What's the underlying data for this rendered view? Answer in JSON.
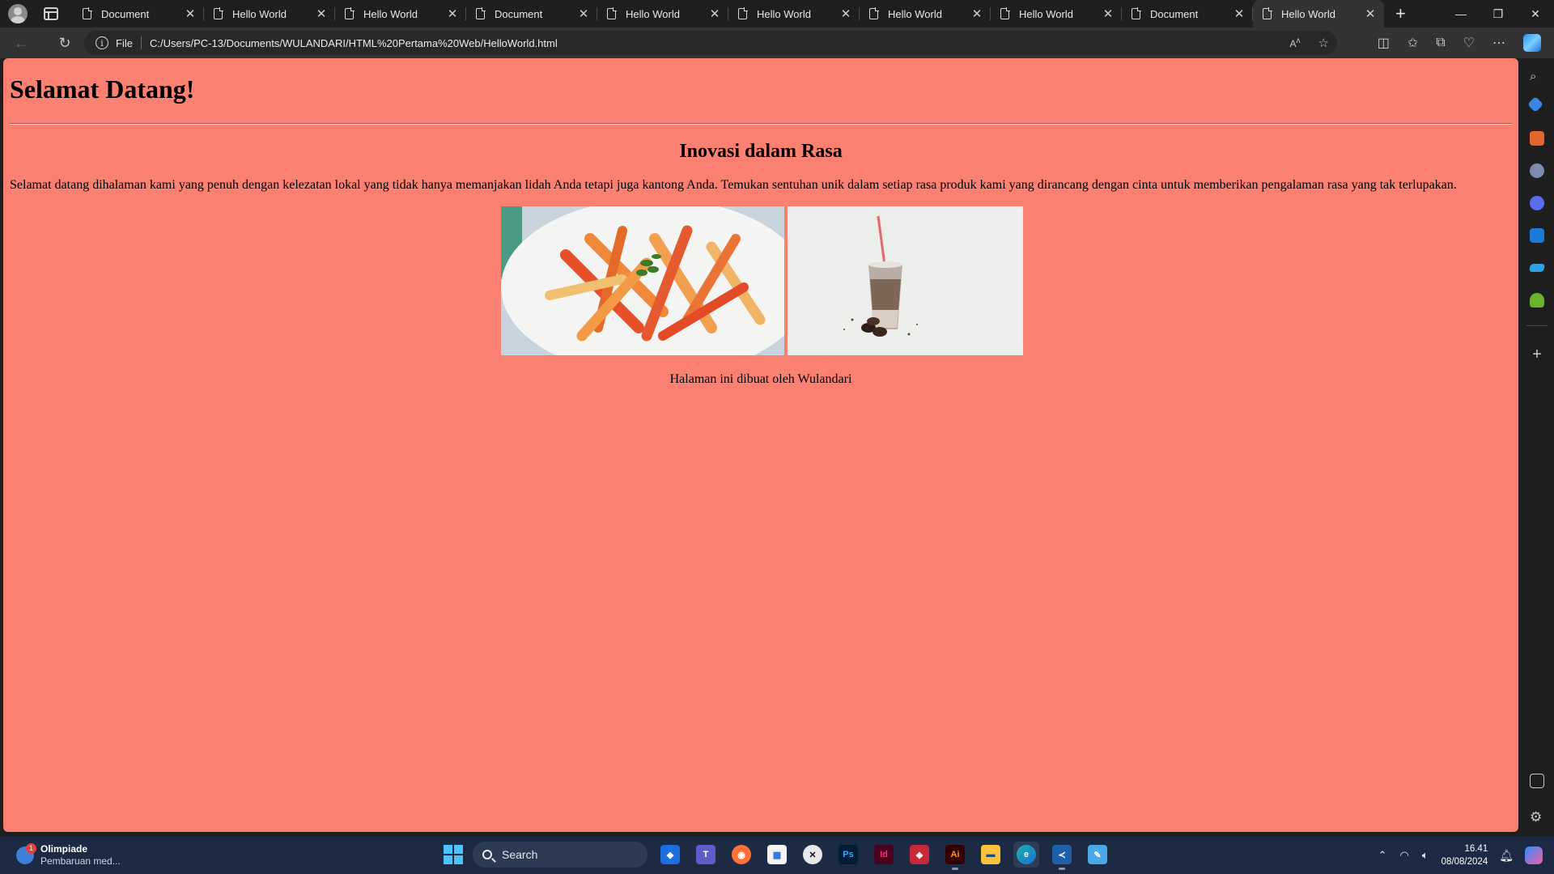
{
  "browser": {
    "tabs": [
      {
        "label": "Document"
      },
      {
        "label": "Hello World"
      },
      {
        "label": "Hello World"
      },
      {
        "label": "Document"
      },
      {
        "label": "Hello World"
      },
      {
        "label": "Hello World"
      },
      {
        "label": "Hello World"
      },
      {
        "label": "Hello World"
      },
      {
        "label": "Document"
      },
      {
        "label": "Hello World",
        "active": true
      }
    ],
    "scheme_label": "File",
    "url": "C:/Users/PC-13/Documents/WULANDARI/HTML%20Pertama%20Web/HelloWorld.html",
    "accent": "#4cc2ff"
  },
  "page": {
    "background": "#fa8072",
    "title": "Selamat Datang!",
    "subtitle": "Inovasi dalam Rasa",
    "intro": "Selamat datang dihalaman kami yang penuh dengan kelezatan lokal yang tidak hanya memanjakan lidah Anda tetapi juga kantong Anda. Temukan sentuhan unik dalam setiap rasa produk kami yang dirancang dengan cinta untuk memberikan pengalaman rasa yang tak terlupakan.",
    "images": [
      {
        "name": "fries-image",
        "depicts": "seasoned cassava fries on a white plate"
      },
      {
        "name": "coffee-drink-image",
        "depicts": "iced coffee drink with straw and coffee beans"
      }
    ],
    "footer": "Halaman ini dibuat oleh Wulandari"
  },
  "taskbar": {
    "weather_title": "Olimpiade",
    "weather_sub": "Pembaruan med...",
    "weather_badge": "1",
    "search_placeholder": "Search",
    "time": "16.41",
    "date": "08/08/2024"
  }
}
